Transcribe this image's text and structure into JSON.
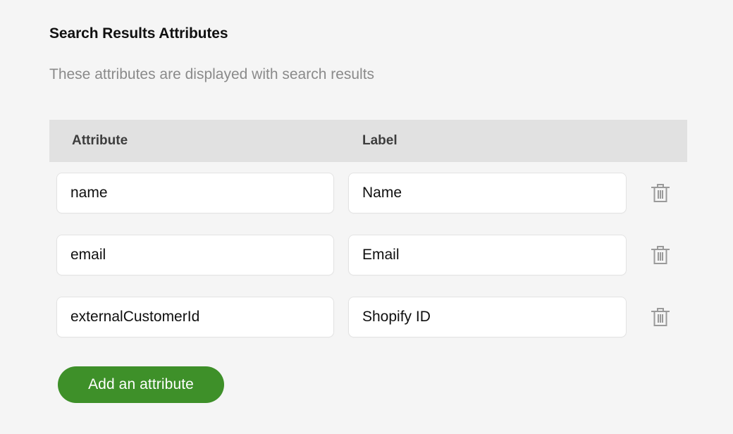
{
  "page": {
    "title": "Search Results Attributes",
    "subtitle": "These attributes are displayed with search results",
    "background_color": "#f5f5f5"
  },
  "table": {
    "header_background": "#e1e1e1",
    "columns": [
      {
        "key": "attribute",
        "label": "Attribute"
      },
      {
        "key": "label",
        "label": "Label"
      }
    ],
    "rows": [
      {
        "attribute": "name",
        "label": "Name",
        "attribute_placeholder": "",
        "label_placeholder": "",
        "delete_icon": "trash-icon"
      },
      {
        "attribute": "email",
        "label": "Email",
        "attribute_placeholder": "",
        "label_placeholder": "",
        "delete_icon": "trash-icon"
      },
      {
        "attribute": "externalCustomerId",
        "label": "Shopify ID",
        "attribute_placeholder": "",
        "label_placeholder": "",
        "delete_icon": "trash-icon"
      }
    ]
  },
  "actions": {
    "add_attribute_label": "Add an attribute",
    "add_attribute_color": "#3e9029"
  }
}
